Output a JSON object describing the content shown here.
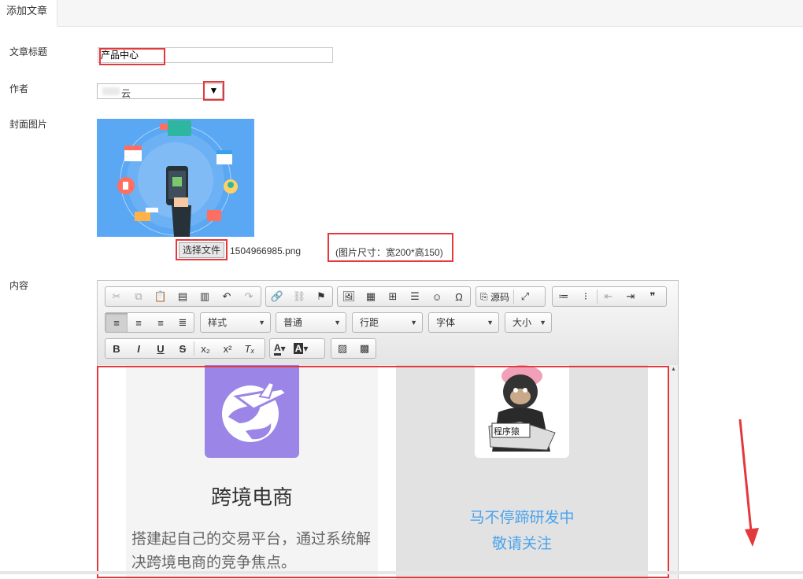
{
  "tab": {
    "label": "添加文章"
  },
  "form": {
    "title_label": "文章标题",
    "title_value": "产品中心",
    "author_label": "作者",
    "author_value": "云",
    "cover_label": "封面图片",
    "file_button": "选择文件",
    "file_name": "1504966985.png",
    "size_hint": "(图片尺寸：宽200*高150)",
    "content_label": "内容"
  },
  "toolbar": {
    "source_label": "源码",
    "style_label": "样式",
    "format_label": "普通",
    "lineheight_label": "行距",
    "font_label": "字体",
    "size_label": "大小",
    "bold": "B",
    "italic": "I",
    "underline": "U",
    "strike": "S",
    "icons": [
      "cut-icon",
      "copy-icon",
      "paste-icon",
      "paste-text-icon",
      "paste-word-icon",
      "undo-icon",
      "redo-icon",
      "link-icon",
      "unlink-icon",
      "anchor-icon",
      "image-icon",
      "flash-icon",
      "table-icon",
      "hr-icon",
      "smiley-icon",
      "special-char-icon",
      "source-icon",
      "maximize-icon",
      "numbered-list-icon",
      "bulleted-list-icon",
      "outdent-icon",
      "indent-icon",
      "blockquote-icon",
      "align-left-icon",
      "align-center-icon",
      "align-right-icon",
      "align-justify-icon",
      "subscript-icon",
      "superscript-icon",
      "remove-format-icon",
      "text-color-icon",
      "bg-color-icon",
      "insert-image-icon",
      "qrcode-icon"
    ]
  },
  "content": {
    "card1_title": "跨境电商",
    "card1_text": "搭建起自己的交易平台，通过系统解决跨境电商的竞争焦点。",
    "card2_line1": "马不停蹄研发中",
    "card2_line2": "敬请关注",
    "card2_line3": "......",
    "monkey_sign": "程序猿"
  },
  "colors": {
    "accent_red": "#e4393c",
    "card_purple": "#9b85e7",
    "link_blue": "#4aa3ee"
  }
}
